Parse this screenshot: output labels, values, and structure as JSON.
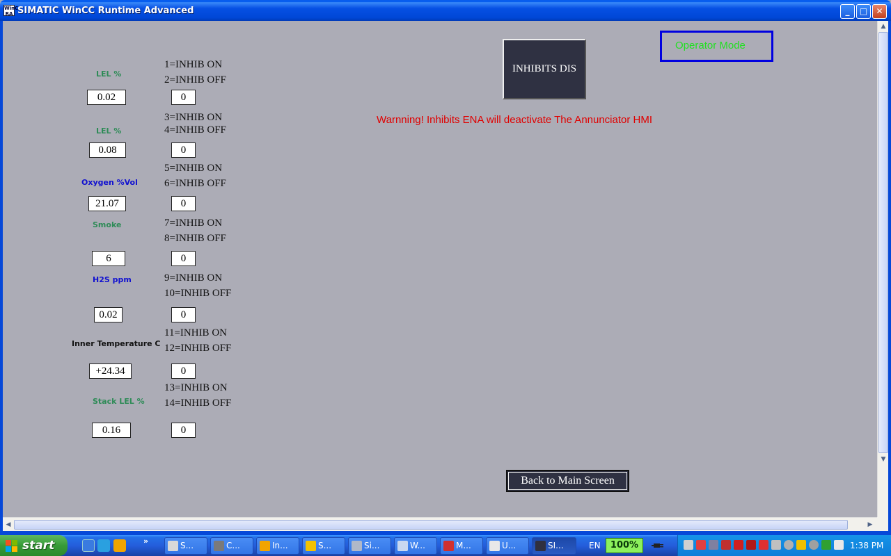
{
  "window": {
    "title": "SIMATIC WinCC Runtime Advanced",
    "icon_text": "WinCC RA",
    "buttons": {
      "minimize": "_",
      "maximize": "□",
      "close": "✕"
    }
  },
  "screen": {
    "mode_label": "Operator Mode",
    "inhibits_button": "INHIBITS DIS",
    "warning": "Warnning! Inhibits ENA will deactivate The Annunciator HMI",
    "back_button": "Back to Main Screen",
    "sensors": [
      {
        "label": "LEL %",
        "label_color": "#2E8B57",
        "value": "0.02",
        "inhibit": "0",
        "on_text": "1=INHIB ON",
        "off_text": "2=INHIB OFF"
      },
      {
        "label": "LEL %",
        "label_color": "#2E8B57",
        "value": "0.08",
        "inhibit": "0",
        "on_text": "3=INHIB ON",
        "off_text": "4=INHIB OFF"
      },
      {
        "label": "Oxygen %Vol",
        "label_color": "#1010D0",
        "value": "21.07",
        "inhibit": "0",
        "on_text": "5=INHIB ON",
        "off_text": "6=INHIB OFF"
      },
      {
        "label": "Smoke",
        "label_color": "#2E8B57",
        "value": "6",
        "inhibit": "0",
        "on_text": "7=INHIB ON",
        "off_text": "8=INHIB OFF"
      },
      {
        "label": "H2S ppm",
        "label_color": "#1010D0",
        "value": "0.02",
        "inhibit": "0",
        "on_text": "9=INHIB ON",
        "off_text": "10=INHIB OFF"
      },
      {
        "label": "Inner Temperature C",
        "label_color": "#111111",
        "value": "+24.34",
        "inhibit": "0",
        "on_text": "11=INHIB ON",
        "off_text": "12=INHIB OFF"
      },
      {
        "label": "Stack LEL %",
        "label_color": "#2E8B57",
        "value": "0.16",
        "inhibit": "0",
        "on_text": "13=INHIB ON",
        "off_text": "14=INHIB OFF"
      }
    ]
  },
  "taskbar": {
    "start_label": "start",
    "tasks": [
      {
        "label": "S...",
        "icon_color": "#D8D8D8"
      },
      {
        "label": "C...",
        "icon_color": "#7A7A7A"
      },
      {
        "label": "In...",
        "icon_color": "#F2A400"
      },
      {
        "label": "S...",
        "icon_color": "#F2C200"
      },
      {
        "label": "Si...",
        "icon_color": "#B0B8C8"
      },
      {
        "label": "W...",
        "icon_color": "#C8D8F0"
      },
      {
        "label": "M...",
        "icon_color": "#D03030"
      },
      {
        "label": "U...",
        "icon_color": "#E8E8E8"
      },
      {
        "label": "SI...",
        "icon_color": "#303040"
      }
    ],
    "language": "EN",
    "zoom": "100%",
    "clock": "1:38 PM"
  },
  "colors": {
    "background": "#ACACB6",
    "button_dark": "#2F3142",
    "warning_red": "#E00000",
    "mode_border": "#0000E0",
    "mode_text": "#22E022"
  }
}
